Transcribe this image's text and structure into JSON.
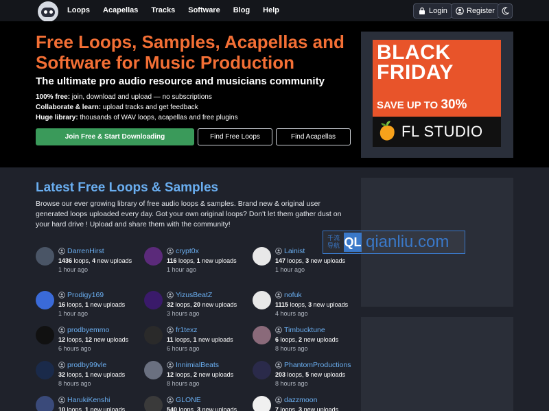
{
  "nav": {
    "links": [
      "Loops",
      "Acapellas",
      "Tracks",
      "Software",
      "Blog",
      "Help"
    ],
    "login_label": "Login",
    "register_label": "Register"
  },
  "hero": {
    "title": "Free Loops, Samples, Acapellas and Software for Music Production",
    "subtitle": "The ultimate pro audio resource and musicians community",
    "features": [
      {
        "bold": "100% free:",
        "text": " join, download and upload — no subscriptions"
      },
      {
        "bold": "Collaborate & learn:",
        "text": " upload tracks and get feedback"
      },
      {
        "bold": "Huge library:",
        "text": " thousands of WAV loops, acapellas and free plugins"
      }
    ],
    "buttons": {
      "join": "Join Free & Start Downloading",
      "find_loops": "Find Free Loops",
      "find_acapellas": "Find Acapellas"
    }
  },
  "ad": {
    "line1": "BLACK",
    "line2": "FRIDAY",
    "save_text": "SAVE UP TO",
    "save_percent": "30%",
    "brand": "FL STUDIO"
  },
  "latest": {
    "title": "Latest Free Loops & Samples",
    "description": "Browse our ever growing library of free audio loops & samples. Brand new & original user generated loops uploaded every day. Got your own original loops? Don't let them gather dust on your hard drive ! Upload and share them with the community!"
  },
  "users": [
    {
      "name": "DarrenHirst",
      "loops": "1436",
      "new": "4",
      "time": "1 hour ago",
      "color": "#4a5566"
    },
    {
      "name": "crypt0x",
      "loops": "116",
      "new": "1",
      "time": "1 hour ago",
      "color": "#5b2a7a"
    },
    {
      "name": "Lainist",
      "loops": "147",
      "new": "3",
      "time": "1 hour ago",
      "color": "#e8e8e8"
    },
    {
      "name": "Prodigy169",
      "loops": "16",
      "new": "1",
      "time": "1 hour ago",
      "color": "#3a6ad8"
    },
    {
      "name": "YizusBeatZ",
      "loops": "32",
      "new": "20",
      "time": "3 hours ago",
      "color": "#3a1a6a"
    },
    {
      "name": "nofuk",
      "loops": "1115",
      "new": "3",
      "time": "4 hours ago",
      "color": "#e8e8e8"
    },
    {
      "name": "prodbyemmo",
      "loops": "12",
      "new": "12",
      "time": "6 hours ago",
      "color": "#111111"
    },
    {
      "name": "fr1texz",
      "loops": "11",
      "new": "1",
      "time": "6 hours ago",
      "color": "#2a2a2a"
    },
    {
      "name": "Timbucktune",
      "loops": "6",
      "new": "2",
      "time": "8 hours ago",
      "color": "#8a6a7a"
    },
    {
      "name": "prodby99vle",
      "loops": "32",
      "new": "1",
      "time": "8 hours ago",
      "color": "#1a2a4a"
    },
    {
      "name": "InnimialBeats",
      "loops": "12",
      "new": "2",
      "time": "8 hours ago",
      "color": "#6a7080"
    },
    {
      "name": "PhantomProductions",
      "loops": "203",
      "new": "5",
      "time": "8 hours ago",
      "color": "#2a2a4a"
    },
    {
      "name": "HarukiKenshi",
      "loops": "10",
      "new": "1",
      "time": "",
      "color": "#3a4a7a"
    },
    {
      "name": "GLONE",
      "loops": "540",
      "new": "3",
      "time": "",
      "color": "#3a3a3a"
    },
    {
      "name": "dazzmoon",
      "loops": "7",
      "new": "3",
      "time": "",
      "color": "#f0f0f0"
    }
  ],
  "watermark": {
    "cn1": "千流",
    "cn2": "导航",
    "badge": "QL",
    "text": "qianliu.com"
  }
}
